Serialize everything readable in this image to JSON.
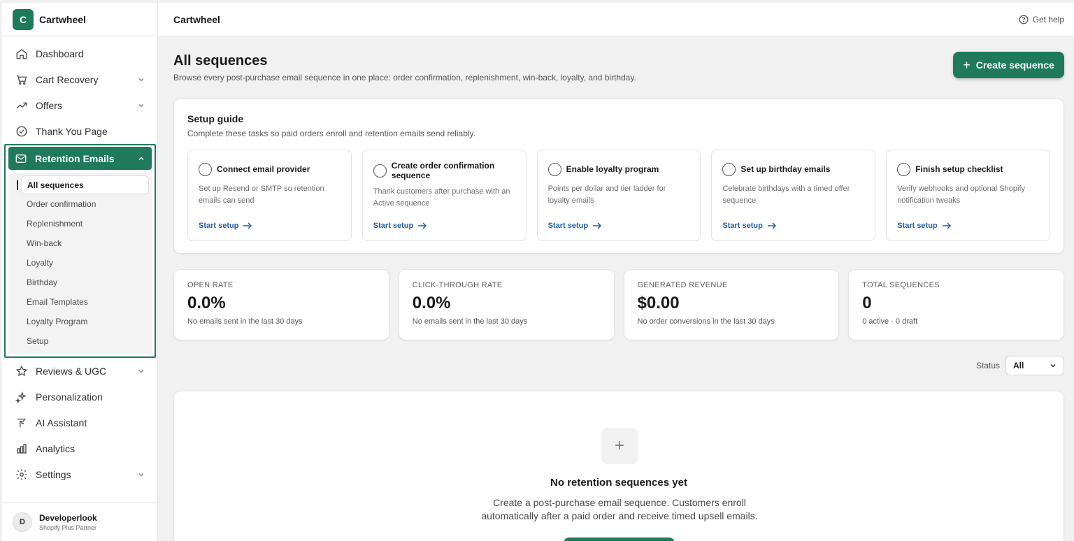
{
  "brand": {
    "logo_letter": "C",
    "name": "Cartwheel"
  },
  "topbar": {
    "title": "Cartwheel",
    "help_label": "Get help"
  },
  "sidebar": {
    "items_top": [
      {
        "label": "Dashboard",
        "icon": "home-icon"
      },
      {
        "label": "Cart Recovery",
        "icon": "cart-icon",
        "chevron": true
      },
      {
        "label": "Offers",
        "icon": "trend-icon",
        "chevron": true
      },
      {
        "label": "Thank You Page",
        "icon": "check-circle-icon"
      }
    ],
    "retention": {
      "label": "Retention Emails",
      "sub_items": [
        "All sequences",
        "Order confirmation",
        "Replenishment",
        "Win-back",
        "Loyalty",
        "Birthday",
        "Email Templates",
        "Loyalty Program",
        "Setup"
      ]
    },
    "items_bottom": [
      {
        "label": "Reviews & UGC",
        "icon": "star-icon",
        "chevron": true
      },
      {
        "label": "Personalization",
        "icon": "sparkle-icon"
      },
      {
        "label": "AI Assistant",
        "icon": "wand-icon"
      },
      {
        "label": "Analytics",
        "icon": "bar-chart-icon"
      },
      {
        "label": "Settings",
        "icon": "gear-icon",
        "chevron": true
      }
    ],
    "user": {
      "initial": "D",
      "name": "Developerlook",
      "role": "Shopify Plus Partner"
    }
  },
  "page": {
    "title": "All sequences",
    "description": "Browse every post-purchase email sequence in one place: order confirmation, replenishment, win-back, loyalty, and birthday.",
    "create_label": "Create sequence"
  },
  "setup": {
    "title": "Setup guide",
    "description": "Complete these tasks so paid orders enroll and retention emails send reliably.",
    "tasks": [
      {
        "title": "Connect email provider",
        "desc": "Set up Resend or SMTP so retention emails can send",
        "link": "Start setup"
      },
      {
        "title": "Create order confirmation sequence",
        "desc": "Thank customers after purchase with an Active sequence",
        "link": "Start setup"
      },
      {
        "title": "Enable loyalty program",
        "desc": "Points per dollar and tier ladder for loyalty emails",
        "link": "Start setup"
      },
      {
        "title": "Set up birthday emails",
        "desc": "Celebrate birthdays with a timed offer sequence",
        "link": "Start setup"
      },
      {
        "title": "Finish setup checklist",
        "desc": "Verify webhooks and optional Shopify notification tweaks",
        "link": "Start setup"
      }
    ]
  },
  "metrics": [
    {
      "label": "OPEN RATE",
      "value": "0.0%",
      "sub": "No emails sent in the last 30 days"
    },
    {
      "label": "CLICK-THROUGH RATE",
      "value": "0.0%",
      "sub": "No emails sent in the last 30 days"
    },
    {
      "label": "GENERATED REVENUE",
      "value": "$0.00",
      "sub": "No order conversions in the last 30 days"
    },
    {
      "label": "TOTAL SEQUENCES",
      "value": "0",
      "sub": "0 active · 0 draft"
    }
  ],
  "filter": {
    "label": "Status",
    "value": "All"
  },
  "empty": {
    "title": "No retention sequences yet",
    "description": "Create a post-purchase email sequence. Customers enroll automatically after a paid order and receive timed upsell emails."
  },
  "colors": {
    "accent": "#1f7a5c",
    "link": "#1e5fa8"
  }
}
